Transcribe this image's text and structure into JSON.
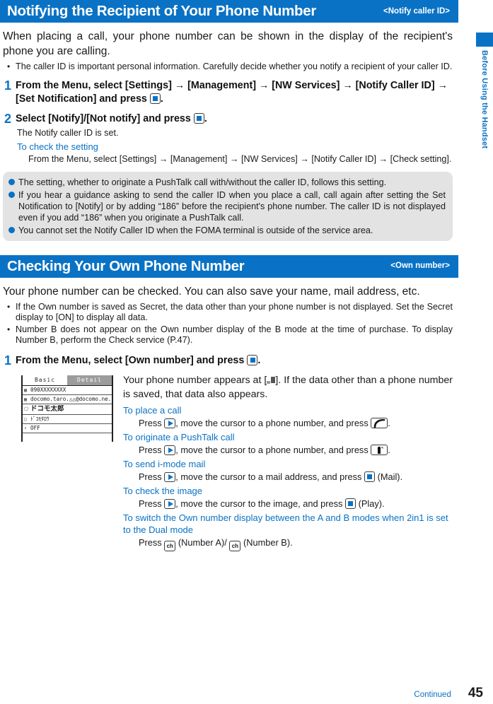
{
  "side_tab": {
    "label": "Before Using the Handset",
    "color": "#0a72c4"
  },
  "sections": [
    {
      "title": "Notifying the Recipient of Your Phone Number",
      "subtitle": "<Notify caller ID>",
      "lead": "When placing a call, your phone number can be shown in the display of the recipient's phone you are calling.",
      "bullets": [
        "The caller ID is important personal information. Carefully decide whether you notify a recipient of your caller ID."
      ],
      "steps": [
        {
          "num": "1",
          "text_before": "From the Menu, select [Settings] → [Management] → [NW Services] → [Notify Caller ID] → [Set Notification] and press",
          "text_after": "."
        },
        {
          "num": "2",
          "text_before": "Select [Notify]/[Not notify] and press",
          "text_after": ".",
          "detail": "The Notify caller ID is set.",
          "sub_head": "To check the setting",
          "sub_detail": "From the Menu, select [Settings] → [Management] → [NW Services] → [Notify Caller ID] → [Check setting]."
        }
      ],
      "notes": [
        "The setting, whether to originate a PushTalk call with/without the caller ID, follows this setting.",
        "If you hear a guidance asking to send the caller ID when you place a call, call again after setting the Set Notification to [Notify] or by adding “186” before the recipient's phone number. The caller ID is not displayed even if you add “186” when you originate a PushTalk call.",
        "You cannot set the Notify Caller ID when the FOMA terminal is outside of the service area."
      ]
    },
    {
      "title": "Checking Your Own Phone Number",
      "subtitle": "<Own number>",
      "lead": "Your phone number can be checked. You can also save your name, mail address, etc.",
      "bullets": [
        "If the Own number is saved as Secret, the data other than your phone number is not displayed. Set the Secret display to [ON] to display all data.",
        "Number B does not appear on the Own number display of the B mode at the time of purchase. To display Number B, perform the Check service (P.47)."
      ],
      "step": {
        "num": "1",
        "text_before": "From the Menu, select [Own number] and press",
        "text_after": "."
      }
    }
  ],
  "phone_mock": {
    "tabs": [
      {
        "label": "Basic",
        "active": false
      },
      {
        "label": "Detail",
        "active": true
      }
    ],
    "rows": [
      {
        "icon": "phone-icon",
        "value": "090XXXXXXXX"
      },
      {
        "icon": "mail-icon",
        "value": "docomo.taro.△△@docomo.ne.jp"
      },
      {
        "icon": "name-icon",
        "value": "ドコモ太郎"
      },
      {
        "icon": "kana-icon",
        "value": "ﾄﾞｺﾓﾀﾛｳ"
      },
      {
        "icon": "secret-icon",
        "value": "OFF"
      }
    ]
  },
  "own_number_body": {
    "paragraph_before": "Your phone number appears at [",
    "paragraph_after": "]. If the data other than a phone number is saved, that data also appears.",
    "actions": [
      {
        "head": "To place a call",
        "pre": "Press",
        "mid": ", move the cursor to a phone number, and press",
        "post": ".",
        "key1": "right-arrow-key-icon",
        "key2": "call-key-icon"
      },
      {
        "head": "To originate a PushTalk call",
        "pre": "Press",
        "mid": ", move the cursor to a phone number, and press",
        "post": ".",
        "key1": "right-arrow-key-icon",
        "key2": "pushtalk-key-icon"
      },
      {
        "head": "To send i-mode mail",
        "pre": "Press",
        "mid": ", move the cursor to a mail address, and press",
        "post": "(Mail).",
        "key1": "right-arrow-key-icon",
        "key2": "select-key-icon"
      },
      {
        "head": "To check the image",
        "pre": "Press",
        "mid": ", move the cursor to the image, and press",
        "post": "(Play).",
        "key1": "right-arrow-key-icon",
        "key2": "select-key-icon"
      },
      {
        "head": "To switch the Own number display between the A and B modes when 2in1 is set to the Dual mode",
        "pre": "Press",
        "mid": "(Number A)/",
        "post": "(Number B).",
        "key1": "ch-key-icon",
        "key2": "ch-key-icon"
      }
    ]
  },
  "footer": {
    "continued": "Continued",
    "page_number": "45"
  }
}
